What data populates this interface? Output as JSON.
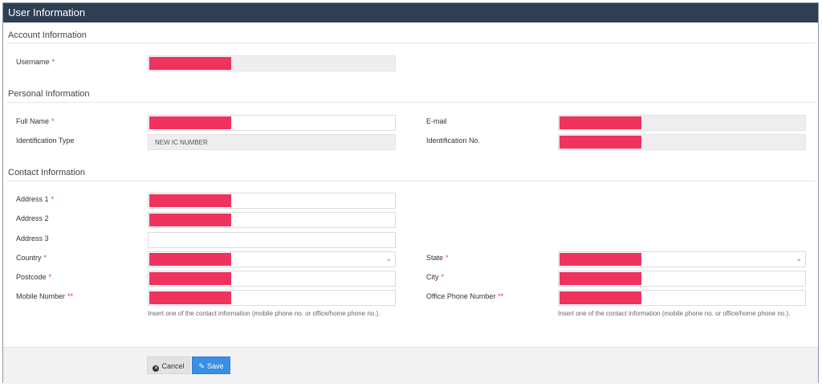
{
  "window": {
    "title": "User Information"
  },
  "sections": {
    "account": "Account Information",
    "personal": "Personal Information",
    "contact": "Contact Information"
  },
  "fields": {
    "username": {
      "label": "Username",
      "required": "*"
    },
    "full_name": {
      "label": "Full Name",
      "required": "*"
    },
    "email": {
      "label": "E-mail"
    },
    "id_type": {
      "label": "Identification Type",
      "value": "NEW IC NUMBER"
    },
    "id_no": {
      "label": "Identification No."
    },
    "address1": {
      "label": "Address 1",
      "required": "*"
    },
    "address2": {
      "label": "Address 2"
    },
    "address3": {
      "label": "Address 3"
    },
    "country": {
      "label": "Country",
      "required": "*"
    },
    "state": {
      "label": "State",
      "required": "*"
    },
    "postcode": {
      "label": "Postcode",
      "required": "*"
    },
    "city": {
      "label": "City",
      "required": "*"
    },
    "mobile": {
      "label": "Mobile Number",
      "required": "**"
    },
    "office_phone": {
      "label": "Office Phone Number",
      "required": "**"
    }
  },
  "hints": {
    "mobile": "Insert one of the contact information (mobile phone no. or office/home phone no.).",
    "office_phone": "Insert one of the contact information (mobile phone no. or office/home phone no.)."
  },
  "buttons": {
    "cancel": "Cancel",
    "save": "Save"
  },
  "colors": {
    "header": "#2e3e53",
    "redaction": "#f0325f",
    "save": "#3b8fe2"
  }
}
